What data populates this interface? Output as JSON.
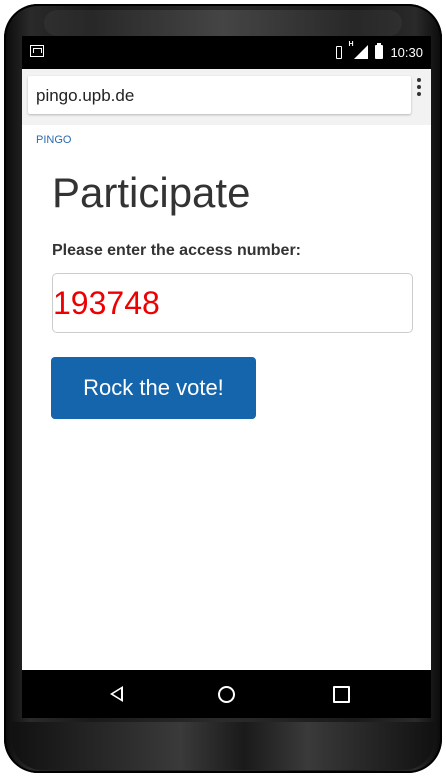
{
  "status_bar": {
    "time": "10:30",
    "icons": [
      "notification-icon",
      "vibrate-icon",
      "signal-icon",
      "battery-icon"
    ]
  },
  "browser": {
    "url": "pingo.upb.de",
    "menu_icon": "overflow-menu-icon"
  },
  "page": {
    "brand_link": "PINGO",
    "title": "Participate",
    "access_label": "Please enter the access number:",
    "access_value": "193748",
    "submit_label": "Rock the vote!"
  },
  "nav_bar": {
    "icons": [
      "back-icon",
      "home-icon",
      "recent-apps-icon"
    ]
  },
  "colors": {
    "accent": "#1565ad",
    "input_text": "#ee0000",
    "link": "#2a6ab0"
  }
}
